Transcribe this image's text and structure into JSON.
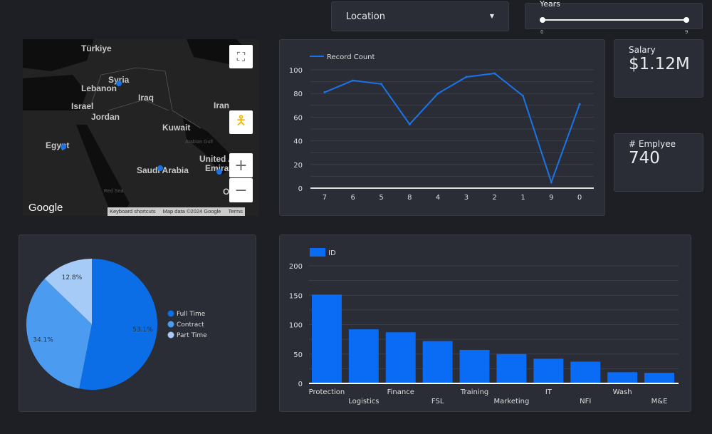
{
  "filters": {
    "location": {
      "label": "Location",
      "icon": "caret-down-icon"
    },
    "years": {
      "label": "Years",
      "min": "0",
      "max": "9",
      "range": [
        0,
        9
      ]
    }
  },
  "scorecards": [
    {
      "label": "Salary",
      "value": "$1.12M"
    },
    {
      "label": "# Emplyee",
      "value": "740"
    }
  ],
  "map": {
    "labels": [
      "Türkiye",
      "Syria",
      "Lebanon",
      "Iraq",
      "Israel",
      "Iran",
      "Jordan",
      "Kuwait",
      "Egypt",
      "Saudi Arabia",
      "United A",
      "Emirat",
      "Red Sea",
      "O",
      "Arabian Gulf"
    ],
    "logo": "Google",
    "footer": {
      "shortcuts": "Keyboard shortcuts",
      "data": "Map data ©2024 Google",
      "terms": "Terms"
    },
    "controls": [
      "fullscreen-icon",
      "pegman-icon",
      "zoom-in-icon",
      "zoom-out-icon"
    ],
    "marker_color": "#1a73e8"
  },
  "chart_data": [
    {
      "type": "line",
      "series": [
        {
          "name": "Record Count",
          "values": [
            81,
            91,
            88,
            54,
            80,
            94,
            97,
            78,
            5,
            71
          ]
        }
      ],
      "categories": [
        "7",
        "6",
        "5",
        "8",
        "4",
        "3",
        "2",
        "1",
        "9",
        "0"
      ],
      "ylim": [
        0,
        100
      ],
      "yticks": [
        "0",
        "20",
        "40",
        "60",
        "80",
        "100"
      ],
      "grid": true,
      "legend": "top-left",
      "color": "#1a73e8"
    },
    {
      "type": "pie",
      "categories": [
        "Full Time",
        "Contract",
        "Part Time"
      ],
      "values": [
        53.1,
        34.1,
        12.8
      ],
      "labels": [
        "53.1%",
        "34.1%",
        "12.8%"
      ],
      "colors": [
        "#0b6ee6",
        "#4b9cf0",
        "#a6cbf7"
      ],
      "legend": "right"
    },
    {
      "type": "bar",
      "series": [
        {
          "name": "ID",
          "values": [
            151,
            92,
            87,
            72,
            57,
            50,
            42,
            37,
            19,
            18
          ]
        }
      ],
      "categories": [
        "Protection",
        "Logistics",
        "Finance",
        "FSL",
        "Training",
        "Marketing",
        "IT",
        "NFI",
        "Wash",
        "M&E"
      ],
      "ylim": [
        0,
        200
      ],
      "yticks": [
        "0",
        "50",
        "100",
        "150",
        "200"
      ],
      "grid": true,
      "legend": "top-left",
      "color": "#0a6cf5"
    }
  ]
}
